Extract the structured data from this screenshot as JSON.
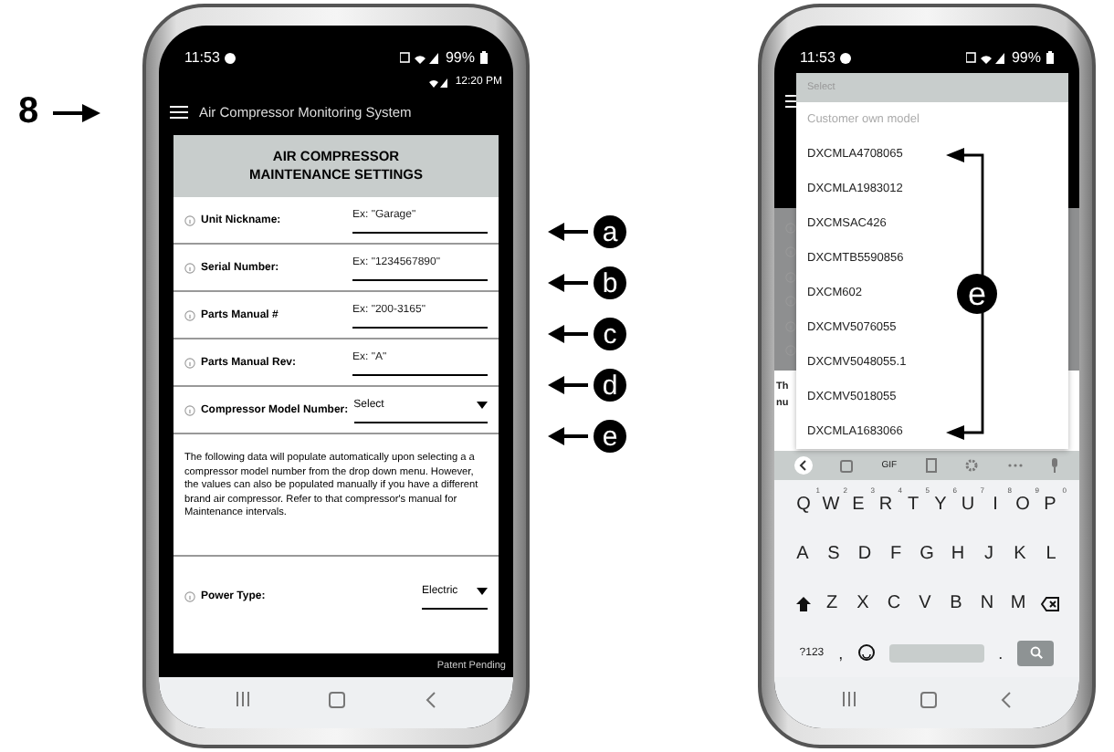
{
  "figure_label": {
    "text": "8"
  },
  "phone_left": {
    "status_bar": {
      "time": "11:53",
      "battery": "99%"
    },
    "app_status": {
      "time": "12:20 PM"
    },
    "app_bar": {
      "title": "Air Compressor Monitoring System"
    },
    "header": "AIR COMPRESSOR MAINTENANCE SETTINGS",
    "fields": [
      {
        "kind": "text",
        "label": "Unit Nickname:",
        "placeholder": "Ex: \"Garage\""
      },
      {
        "kind": "text",
        "label": "Serial Number:",
        "placeholder": "Ex: \"1234567890\""
      },
      {
        "kind": "text",
        "label": "Parts Manual #",
        "placeholder": "Ex: \"200-3165\""
      },
      {
        "kind": "text",
        "label": "Parts Manual Rev:",
        "placeholder": "Ex: \"A\""
      },
      {
        "kind": "select",
        "label": "Compressor Model Number:",
        "value": "Select"
      }
    ],
    "note": "The following data will populate automatically upon selecting a a compressor model number from the drop down menu. However, the values can also be populated manually if you have a different brand air compressor. Refer to that compressor's manual for Maintenance intervals.",
    "power": {
      "kind": "select",
      "label": "Power Type:",
      "value": "Electric"
    },
    "footer": "Patent Pending"
  },
  "callouts": [
    "a",
    "b",
    "c",
    "d",
    "e"
  ],
  "phone_right": {
    "status_bar": {
      "time": "11:53",
      "battery": "99%"
    },
    "background_text": [
      "Th",
      "nu"
    ],
    "dropdown": {
      "header": "Select",
      "options": [
        {
          "label": "Customer own model",
          "disabled": true
        },
        {
          "label": "DXCMLA4708065",
          "disabled": false
        },
        {
          "label": "DXCMLA1983012",
          "disabled": false
        },
        {
          "label": "DXCMSAC426",
          "disabled": false
        },
        {
          "label": "DXCMTB5590856",
          "disabled": false
        },
        {
          "label": "DXCM602",
          "disabled": false
        },
        {
          "label": "DXCMV5076055",
          "disabled": false
        },
        {
          "label": "DXCMV5048055.1",
          "disabled": false
        },
        {
          "label": "DXCMV5018055",
          "disabled": false
        },
        {
          "label": "DXCMLA1683066",
          "disabled": false
        }
      ]
    },
    "callout": "e",
    "keyboard": {
      "toolbar": {
        "gif": "GIF"
      },
      "top_row": [
        {
          "key": "Q",
          "hint": "1"
        },
        {
          "key": "W",
          "hint": "2"
        },
        {
          "key": "E",
          "hint": "3"
        },
        {
          "key": "R",
          "hint": "4"
        },
        {
          "key": "T",
          "hint": "5"
        },
        {
          "key": "Y",
          "hint": "6"
        },
        {
          "key": "U",
          "hint": "7"
        },
        {
          "key": "I",
          "hint": "8"
        },
        {
          "key": "O",
          "hint": "9"
        },
        {
          "key": "P",
          "hint": "0"
        }
      ],
      "home_row": [
        {
          "key": "A"
        },
        {
          "key": "S"
        },
        {
          "key": "D"
        },
        {
          "key": "F"
        },
        {
          "key": "G"
        },
        {
          "key": "H"
        },
        {
          "key": "J"
        },
        {
          "key": "K"
        },
        {
          "key": "L"
        }
      ],
      "bottom_row": [
        {
          "key": "Z"
        },
        {
          "key": "X"
        },
        {
          "key": "C"
        },
        {
          "key": "V"
        },
        {
          "key": "B"
        },
        {
          "key": "N"
        },
        {
          "key": "M"
        }
      ],
      "symbols": "?123",
      "comma": ",",
      "period": "."
    }
  }
}
